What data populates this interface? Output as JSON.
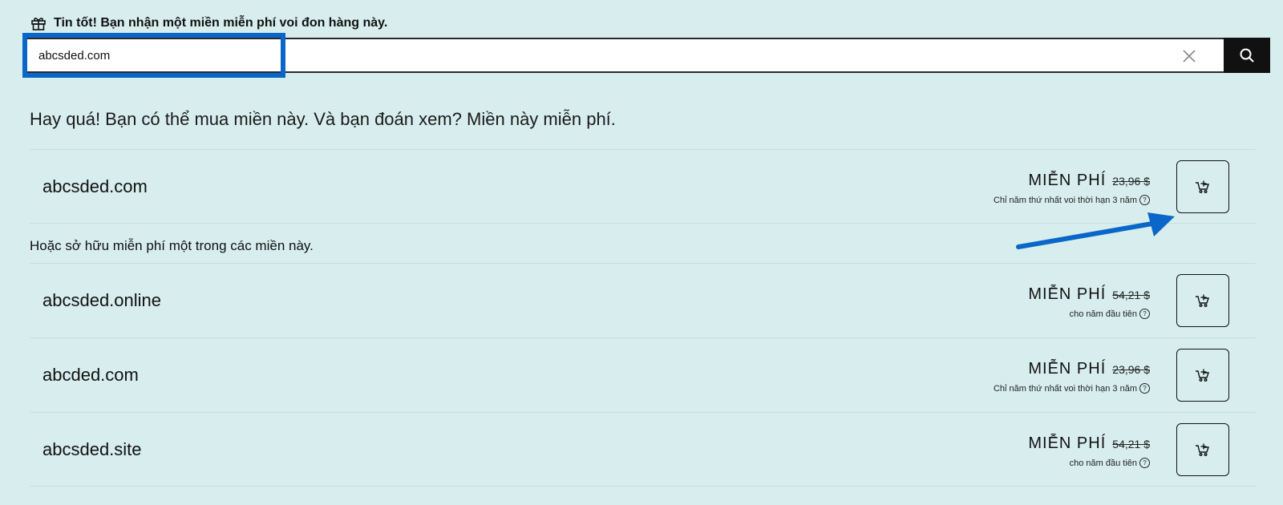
{
  "promo": {
    "icon": "gift-icon",
    "text": "Tin tốt! Bạn nhận một miền miễn phí voi đon hàng này."
  },
  "search": {
    "value": "abcsded.com",
    "placeholder": "",
    "clear_icon": "close-icon",
    "button_icon": "search-icon",
    "highlight_color": "#0a66c8"
  },
  "headline": "Hay quá! Bạn có thể mua miền này. Và bạn đoán xem? Miền này miễn phí.",
  "featured": {
    "domain": "abcsded.com",
    "price_label": "MIỄN PHÍ",
    "old_price": "23,96 $",
    "note": "Chỉ năm thứ nhất voi thời hạn 3 năm",
    "cart_icon": "add-to-cart-icon"
  },
  "alternatives_heading": "Hoặc sở hữu miễn phí một trong các miền này.",
  "alternatives": [
    {
      "domain": "abcsded.online",
      "price_label": "MIỄN PHÍ",
      "old_price": "54,21 $",
      "note": "cho năm đầu tiên",
      "cart_icon": "add-to-cart-icon"
    },
    {
      "domain": "abcded.com",
      "price_label": "MIỄN PHÍ",
      "old_price": "23,96 $",
      "note": "Chỉ năm thứ nhất voi thời hạn 3 năm",
      "cart_icon": "add-to-cart-icon"
    },
    {
      "domain": "abcsded.site",
      "price_label": "MIỄN PHÍ",
      "old_price": "54,21 $",
      "note": "cho năm đầu tiên",
      "cart_icon": "add-to-cart-icon"
    }
  ],
  "annotation": {
    "arrow_color": "#0a66c8"
  }
}
